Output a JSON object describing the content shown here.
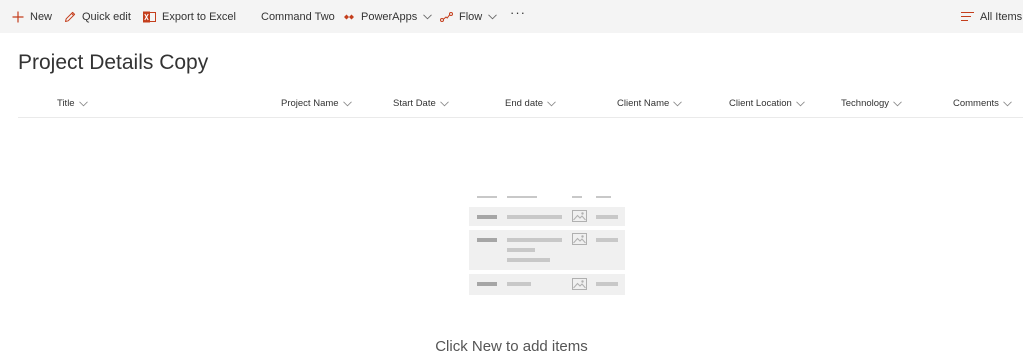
{
  "command_bar": {
    "new_label": "New",
    "quick_edit_label": "Quick edit",
    "export_label": "Export to Excel",
    "command_two_label": "Command Two",
    "powerapps_label": "PowerApps",
    "flow_label": "Flow",
    "more_label": "···",
    "view_label": "All Items"
  },
  "page": {
    "title": "Project Details Copy"
  },
  "columns": [
    {
      "label": "Title"
    },
    {
      "label": "Project Name"
    },
    {
      "label": "Start Date"
    },
    {
      "label": "End date"
    },
    {
      "label": "Client Name"
    },
    {
      "label": "Client Location"
    },
    {
      "label": "Technology"
    },
    {
      "label": "Comments"
    }
  ],
  "empty_state": {
    "message": "Click New to add items"
  },
  "icons": {
    "new": "plus-icon",
    "quick_edit": "pencil-icon",
    "export": "excel-icon",
    "powerapps": "powerapps-icon",
    "flow": "flow-icon",
    "view": "list-lines-icon"
  },
  "colors": {
    "accent": "#c43e1c",
    "command_bar_bg": "#f4f4f4"
  }
}
